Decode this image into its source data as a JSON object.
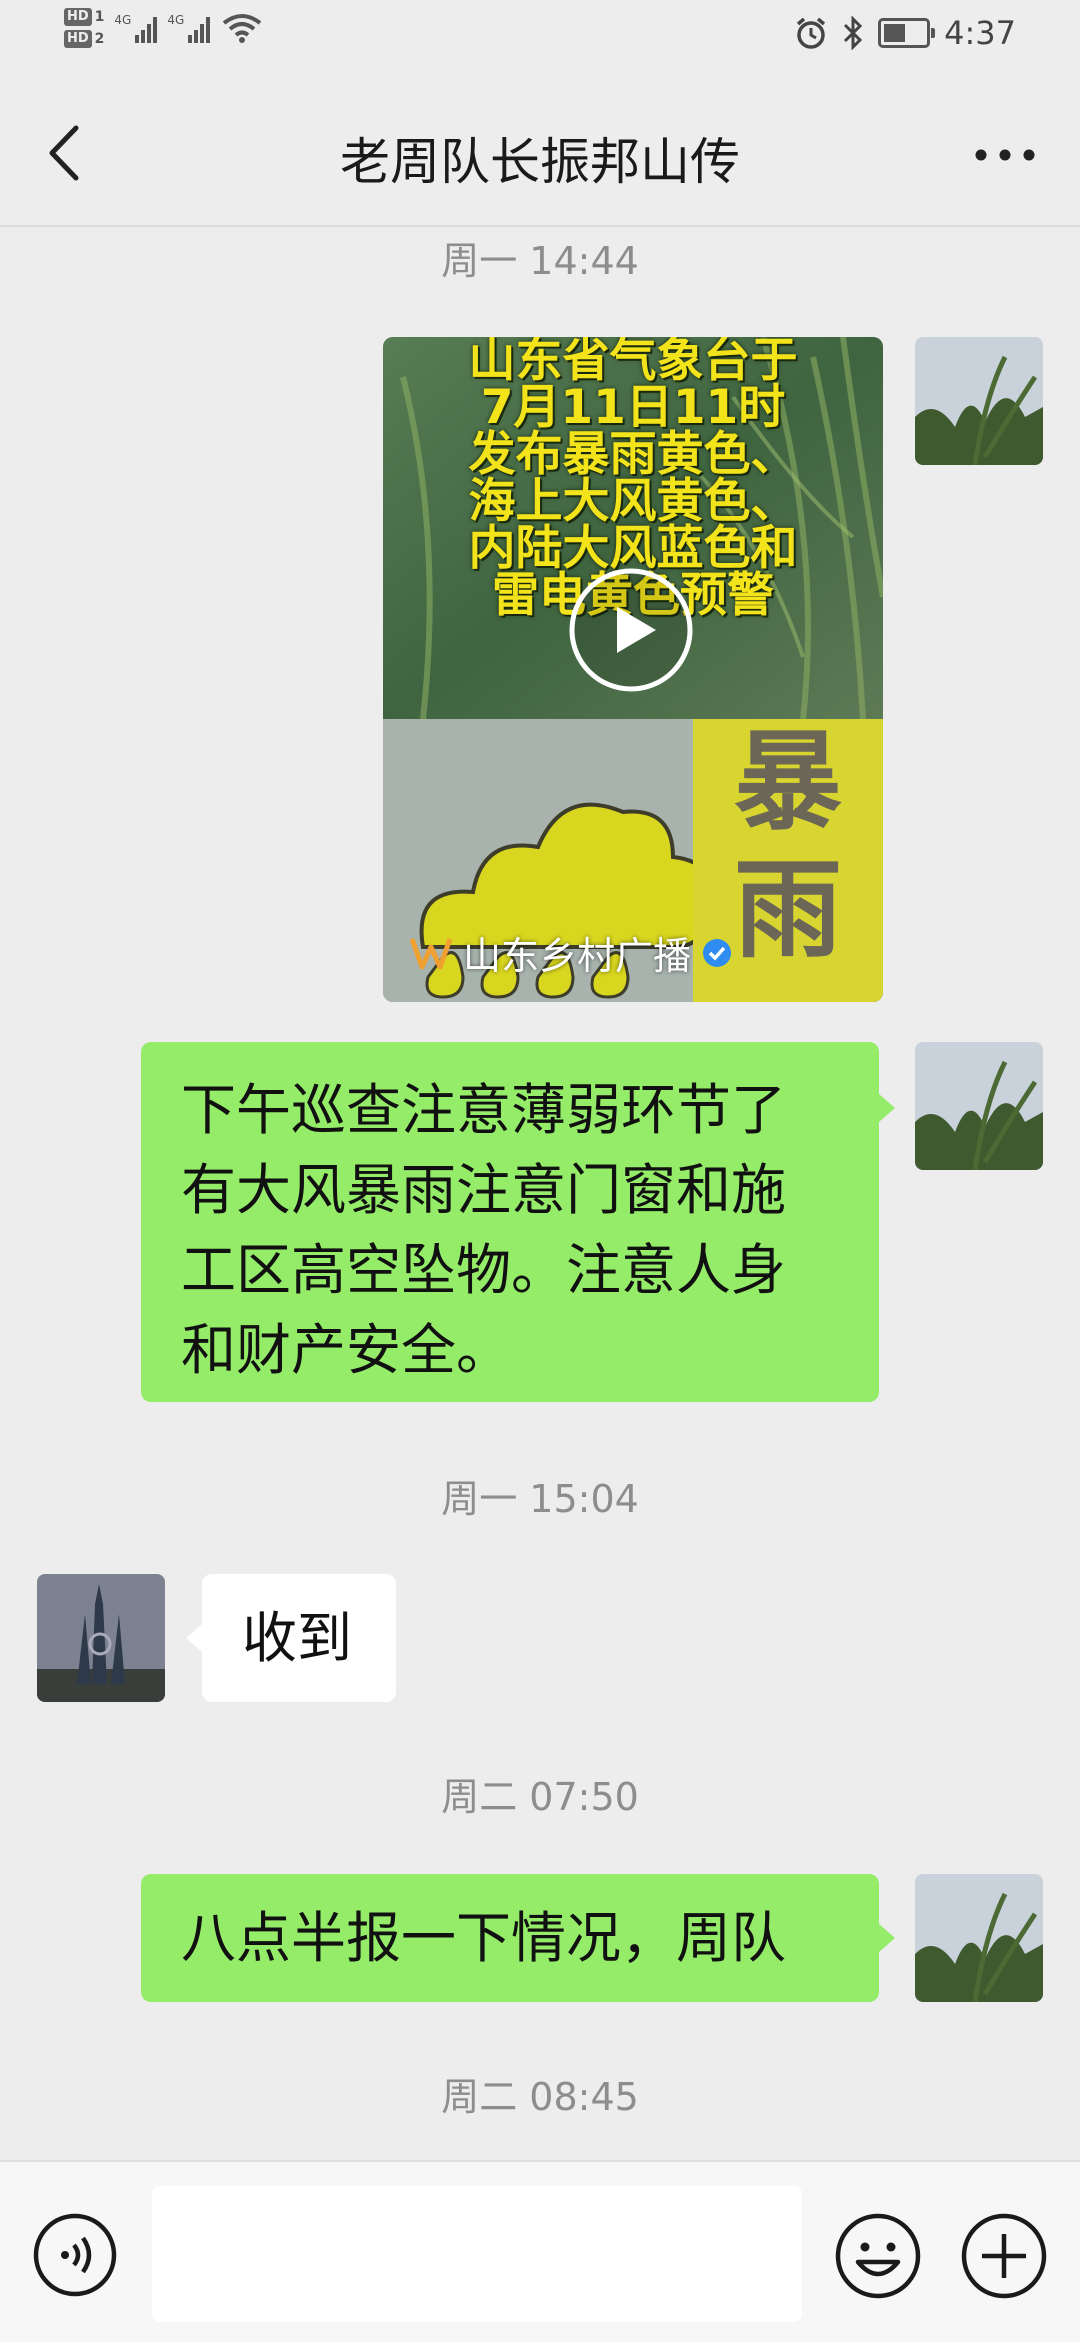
{
  "status_bar": {
    "sim1": "HD",
    "sim1_slot": "1",
    "sim2": "HD",
    "sim2_slot": "2",
    "net1": "4G",
    "net2": "4G",
    "time": "4:37",
    "icons": [
      "alarm-icon",
      "bluetooth-icon",
      "battery-icon"
    ]
  },
  "header": {
    "title": "老周队长振邦山传",
    "back_icon": "chevron-left-icon",
    "more_icon": "more-dots-icon"
  },
  "messages": [
    {
      "type": "timestamp",
      "text": "周一 14:44"
    },
    {
      "type": "video",
      "side": "right",
      "video": {
        "text_lines": [
          "山东省气象台于",
          "7月11日11时",
          "发布暴雨黄色、",
          "海上大风黄色、",
          "内陆大风蓝色和",
          "雷电黄色预警"
        ],
        "sign_chars": [
          "暴",
          "雨"
        ],
        "source": "山东乡村广播",
        "verified_icon": "verified-badge-icon",
        "play_icon": "play-icon"
      }
    },
    {
      "type": "text",
      "side": "right",
      "text": "下午巡查注意薄弱环节了有大风暴雨注意门窗和施工区高空坠物。注意人身和财产安全。"
    },
    {
      "type": "timestamp",
      "text": "周一 15:04"
    },
    {
      "type": "text",
      "side": "left",
      "text": "收到"
    },
    {
      "type": "timestamp",
      "text": "周二 07:50"
    },
    {
      "type": "text",
      "side": "right",
      "text": "八点半报一下情况，周队"
    },
    {
      "type": "timestamp",
      "text": "周二 08:45"
    }
  ],
  "input_bar": {
    "value": "",
    "voice_icon": "voice-icon",
    "emoji_icon": "emoji-icon",
    "plus_icon": "plus-icon"
  },
  "colors": {
    "background": "#ededed",
    "bubble_sent": "#95ec69",
    "bubble_received": "#ffffff",
    "timestamp": "#8d8d8d",
    "video_text": "#f3e31a"
  }
}
